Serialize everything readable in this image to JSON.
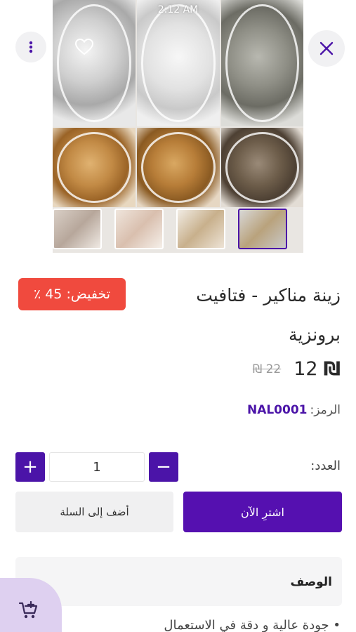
{
  "status": {
    "time": "2:12 AM"
  },
  "gallery": {
    "tiles": [
      "silver",
      "clear",
      "grey",
      "gold",
      "bronze",
      "dark"
    ],
    "thumbnails": [
      "thumb-1",
      "thumb-2",
      "thumb-3",
      "thumb-4"
    ],
    "selected_thumbnail": 4
  },
  "icons": {
    "more": "more-vertical-icon",
    "favorite": "heart-icon",
    "close": "close-icon",
    "cart": "cart-add-icon"
  },
  "product": {
    "discount_label": "تخفيض: 45 ٪",
    "title": "زينة مناكير - فتافيت برونزية",
    "price": "12",
    "currency_symbol": "₪",
    "old_price": "22 ₪",
    "sku_label": "الرمز:",
    "sku_value": "NAL0001"
  },
  "quantity": {
    "label": "العدد:",
    "value": "1",
    "plus": "+",
    "minus": "−"
  },
  "actions": {
    "add_to_cart": "أضف إلى السلة",
    "buy_now": "اشترِ الآن"
  },
  "description": {
    "title": "الوصف",
    "first_line": "• جودة عالية و دقة في الاستعمال"
  },
  "colors": {
    "accent": "#4b14a8",
    "buy_button": "#5510b0",
    "discount_badge": "#f04a3e",
    "fab_bg": "#ded0f0"
  }
}
